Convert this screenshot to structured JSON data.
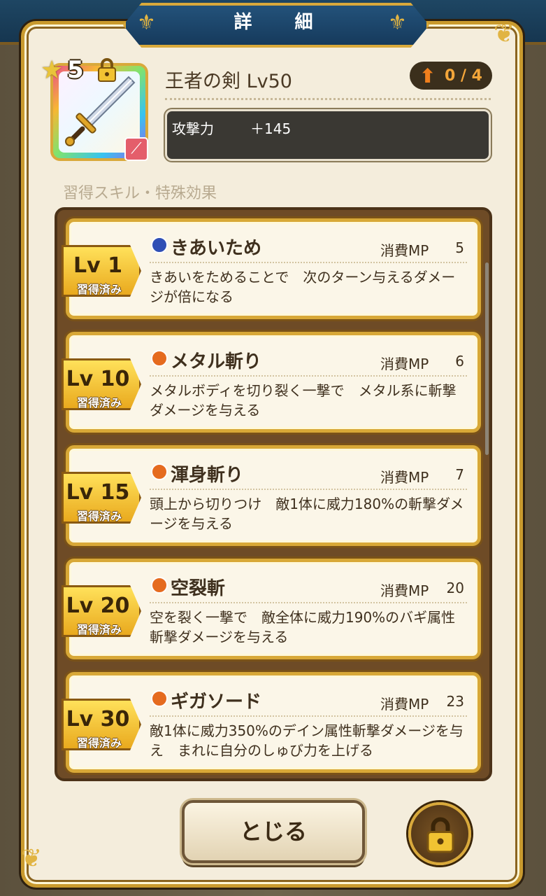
{
  "dialog": {
    "title": "詳 細",
    "close_label": "とじる"
  },
  "item": {
    "name": "王者の剣 Lv50",
    "rarity": "5",
    "enhance": "0 / 4",
    "stat_label": "攻撃力",
    "stat_value": "＋145",
    "section_label": "習得スキル・特殊効果"
  },
  "skills": [
    {
      "lv": "Lv 1",
      "status": "習得済み",
      "name": "きあいため",
      "mp_label": "消費MP",
      "mp": "5",
      "desc": "きあいをためることで　次のターン与えるダメージが倍になる",
      "icon_color": "#2f4fb5"
    },
    {
      "lv": "Lv 10",
      "status": "習得済み",
      "name": "メタル斬り",
      "mp_label": "消費MP",
      "mp": "6",
      "desc": "メタルボディを切り裂く一撃で　メタル系に斬撃ダメージを与える",
      "icon_color": "#e56b1f"
    },
    {
      "lv": "Lv 15",
      "status": "習得済み",
      "name": "渾身斬り",
      "mp_label": "消費MP",
      "mp": "7",
      "desc": "頭上から切りつけ　敵1体に威力180%の斬撃ダメージを与える",
      "icon_color": "#e56b1f"
    },
    {
      "lv": "Lv 20",
      "status": "習得済み",
      "name": "空裂斬",
      "mp_label": "消費MP",
      "mp": "20",
      "desc": "空を裂く一撃で　敵全体に威力190%のバギ属性斬撃ダメージを与える",
      "icon_color": "#e56b1f"
    },
    {
      "lv": "Lv 30",
      "status": "習得済み",
      "name": "ギガソード",
      "mp_label": "消費MP",
      "mp": "23",
      "desc": "敵1体に威力350%のデイン属性斬撃ダメージを与え　まれに自分のしゅび力を上げる",
      "icon_color": "#e56b1f"
    }
  ],
  "icons": {
    "rarity": "star-icon",
    "lock": "lock-icon",
    "enhance": "up-arrow-icon",
    "weapon_type": "sword-type-icon"
  }
}
